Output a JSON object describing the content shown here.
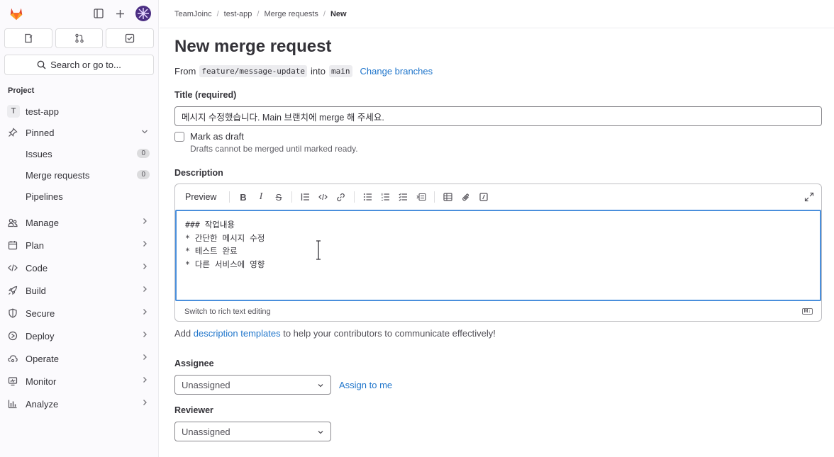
{
  "sidebar": {
    "search_label": "Search or go to...",
    "section_label": "Project",
    "project": {
      "badge": "T",
      "name": "test-app"
    },
    "pinned_label": "Pinned",
    "pinned_items": [
      {
        "label": "Issues",
        "count": "0"
      },
      {
        "label": "Merge requests",
        "count": "0"
      },
      {
        "label": "Pipelines"
      }
    ],
    "nav": [
      {
        "label": "Manage",
        "icon": "users-icon"
      },
      {
        "label": "Plan",
        "icon": "calendar-icon"
      },
      {
        "label": "Code",
        "icon": "code-icon"
      },
      {
        "label": "Build",
        "icon": "rocket-icon"
      },
      {
        "label": "Secure",
        "icon": "shield-icon"
      },
      {
        "label": "Deploy",
        "icon": "deploy-icon"
      },
      {
        "label": "Operate",
        "icon": "cloud-gear-icon"
      },
      {
        "label": "Monitor",
        "icon": "monitor-icon"
      },
      {
        "label": "Analyze",
        "icon": "chart-icon"
      }
    ]
  },
  "breadcrumb": [
    "TeamJoinc",
    "test-app",
    "Merge requests",
    "New"
  ],
  "page_title": "New merge request",
  "branches": {
    "from_label": "From",
    "source": "feature/message-update",
    "into_label": "into",
    "target": "main",
    "change_link": "Change branches"
  },
  "title_field": {
    "label": "Title (required)",
    "value": "메시지 수정했습니다. Main 브랜치에 merge 해 주세요."
  },
  "draft": {
    "label": "Mark as draft",
    "help": "Drafts cannot be merged until marked ready."
  },
  "description": {
    "label": "Description",
    "preview_label": "Preview",
    "lines": [
      "### 작업내용",
      "* 간단한 메시지 수정",
      "* 테스트 완료",
      "* 다른 서비스에 영향"
    ],
    "switch_label": "Switch to rich text editing",
    "md_badge": "M↓"
  },
  "templates_help": {
    "prefix": "Add ",
    "link": "description templates",
    "suffix": " to help your contributors to communicate effectively!"
  },
  "assignee": {
    "label": "Assignee",
    "value": "Unassigned",
    "assign_link": "Assign to me"
  },
  "reviewer": {
    "label": "Reviewer",
    "value": "Unassigned"
  },
  "colors": {
    "accent": "#1f75cb",
    "focus": "#4a8fdc",
    "logo": "#e24329"
  }
}
